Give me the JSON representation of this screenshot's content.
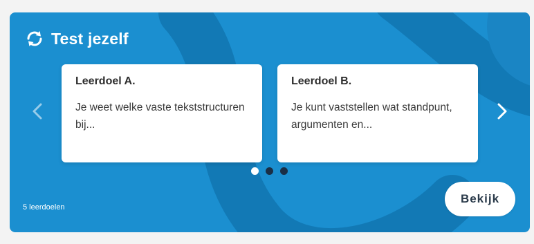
{
  "header": {
    "title": "Test jezelf",
    "icon": "refresh-icon"
  },
  "carousel": {
    "slides": [
      {
        "title": "Leerdoel A.",
        "text": "Je weet welke vaste tekststructuren bij..."
      },
      {
        "title": "Leerdoel B.",
        "text": "Je kunt vaststellen wat standpunt, argumenten en..."
      }
    ],
    "dots_count": 3,
    "active_dot": 1,
    "prev_icon": "chevron-left-icon",
    "next_icon": "chevron-right-icon"
  },
  "footer": {
    "count_label": "5 leerdoelen",
    "button_label": "Bekijk"
  },
  "colors": {
    "card_bg": "#1b8fd0",
    "deco": "#0f6fa6",
    "page_bg": "#f3f3f3",
    "inactive_dot": "#1a2f46"
  }
}
